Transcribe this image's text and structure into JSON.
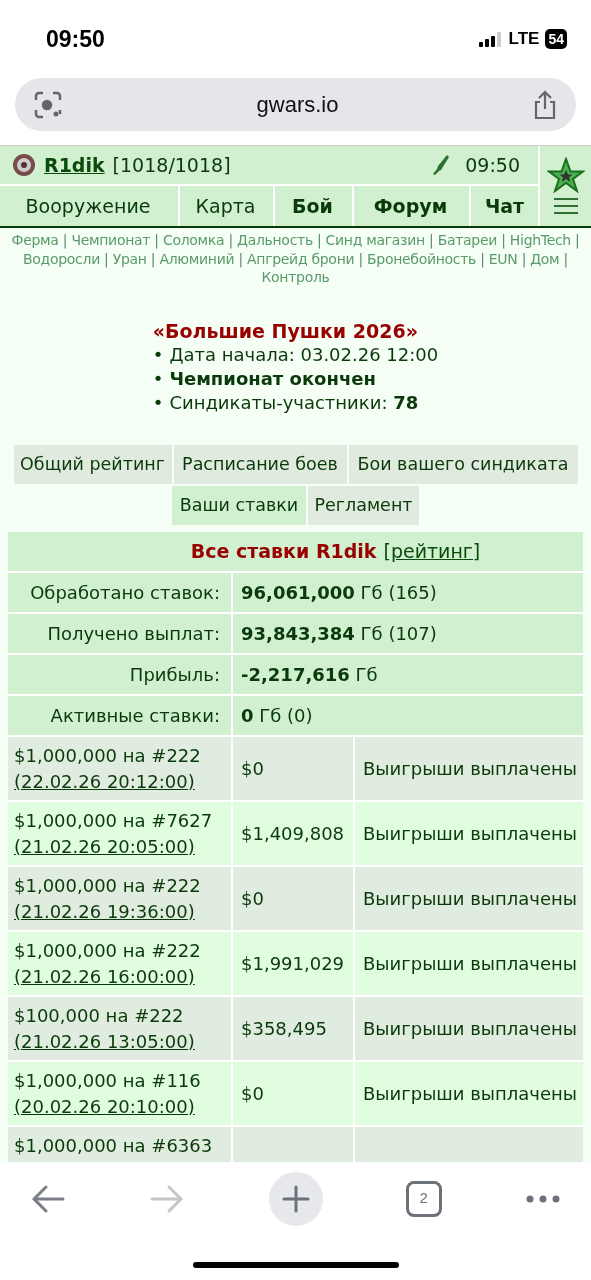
{
  "status_bar": {
    "time": "09:50",
    "network": "LTE",
    "battery": "54"
  },
  "address_bar": {
    "url": "gwars.io"
  },
  "header": {
    "username": "R1dik",
    "hp": "[1018/1018]",
    "time": "09:50"
  },
  "nav": [
    {
      "label": "Вооружение",
      "bold": false
    },
    {
      "label": "Карта",
      "bold": false
    },
    {
      "label": "Бой",
      "bold": true
    },
    {
      "label": "Форум",
      "bold": true
    },
    {
      "label": "Чат",
      "bold": true
    }
  ],
  "links_separator": "|",
  "links": [
    "Ферма",
    "Чемпионат",
    "Соломка",
    "Дальность",
    "Синд магазин",
    "Батареи",
    "HighTech",
    "Водоросли",
    "Уран",
    "Алюминий",
    "Апгрейд брони",
    "Бронебойность",
    "EUN",
    "Дом",
    "Контроль"
  ],
  "championship": {
    "title": "«Большие Пушки 2026»",
    "bullet": "•",
    "items": [
      "Дата начала: 03.02.26 12:00",
      "**Чемпионат окончен**",
      "Синдикаты-участники: **78**"
    ]
  },
  "tabs": [
    {
      "label": "Общий рейтинг",
      "selected": false
    },
    {
      "label": "Расписание боев",
      "selected": false
    },
    {
      "label": "Бои вашего синдиката",
      "selected": false
    },
    {
      "label": "Ваши ставки",
      "selected": true
    },
    {
      "label": "Регламент",
      "selected": false
    }
  ],
  "bets": {
    "title": "Все ставки R1dik",
    "link": "[рейтинг]",
    "summary": [
      {
        "label": "Обработано ставок:",
        "value": "**96,061,000** Гб (165)"
      },
      {
        "label": "Получено выплат:",
        "value": "**93,843,384** Гб (107)"
      },
      {
        "label": "Прибыль:",
        "value": "**-2,217,616** Гб"
      },
      {
        "label": "Активные ставки:",
        "value": "**0** Гб (0)"
      }
    ],
    "rows": [
      {
        "bet": "$1,000,000 на #222",
        "date": "(22.02.26 20:12:00)",
        "payout": "$0",
        "status": "Выигрыши выплачены"
      },
      {
        "bet": "$1,000,000 на #7627",
        "date": "(21.02.26 20:05:00)",
        "payout": "$1,409,808",
        "status": "Выигрыши выплачены"
      },
      {
        "bet": "$1,000,000 на #222",
        "date": "(21.02.26 19:36:00)",
        "payout": "$0",
        "status": "Выигрыши выплачены"
      },
      {
        "bet": "$1,000,000 на #222",
        "date": "(21.02.26 16:00:00)",
        "payout": "$1,991,029",
        "status": "Выигрыши выплачены"
      },
      {
        "bet": "$100,000 на #222",
        "date": "(21.02.26 13:05:00)",
        "payout": "$358,495",
        "status": "Выигрыши выплачены"
      },
      {
        "bet": "$1,000,000 на #116",
        "date": "(20.02.26 20:10:00)",
        "payout": "$0",
        "status": "Выигрыши выплачены"
      },
      {
        "bet": "$1,000,000 на #6363"
      }
    ]
  },
  "toolbar": {
    "tabs_count": "2"
  }
}
